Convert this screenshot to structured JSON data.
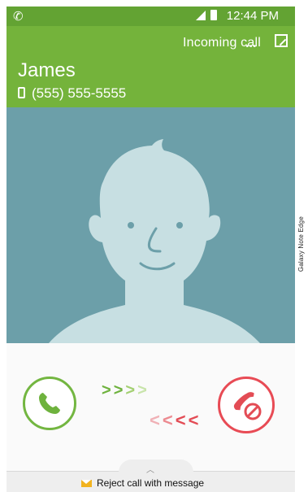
{
  "status_bar": {
    "time": "12:44 PM"
  },
  "header": {
    "incoming_label": "Incoming call",
    "dots": "•••",
    "caller_name": "James",
    "caller_number": "(555) 555-5555"
  },
  "side_label": "Galaxy Note Edge",
  "actions": {
    "answer_arrows": [
      ">",
      ">",
      ">",
      ">"
    ],
    "reject_arrows": [
      "<",
      "<",
      "<",
      "<"
    ],
    "reject_message_label": "Reject call with message"
  },
  "colors": {
    "header_green": "#74b33b",
    "answer_green": "#73b641",
    "reject_red": "#e84b55",
    "photo_bg": "#6c9fa9"
  },
  "icons": {
    "answer": "phone-handset-icon",
    "reject": "end-call-icon",
    "expand": "expand-icon",
    "message": "envelope-icon"
  }
}
